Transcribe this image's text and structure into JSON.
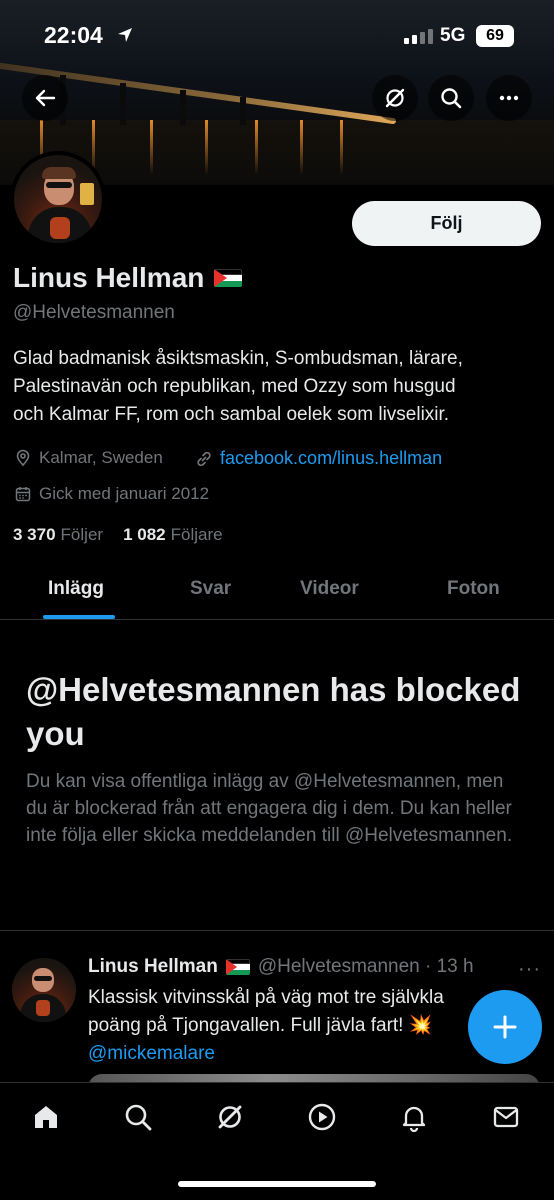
{
  "status_bar": {
    "time": "22:04",
    "network": "5G",
    "battery": "69"
  },
  "profile": {
    "name": "Linus Hellman",
    "handle": "@Helvetesmannen",
    "follow_label": "Följ",
    "bio_lines": [
      "Glad badmanisk åsiktsmaskin, S-ombudsman, lärare,",
      "Palestinavän och republikan, med Ozzy som husgud",
      "och Kalmar FF, rom och sambal oelek som livselixir."
    ],
    "location": "Kalmar, Sweden",
    "link": "facebook.com/linus.hellman",
    "joined": "Gick med januari 2012",
    "following_count": "3 370",
    "following_label": "Följer",
    "followers_count": "1 082",
    "followers_label": "Följare"
  },
  "tabs": [
    {
      "label": "Inlägg",
      "active": true
    },
    {
      "label": "Svar",
      "active": false
    },
    {
      "label": "Videor",
      "active": false
    },
    {
      "label": "Foton",
      "active": false
    }
  ],
  "blocked": {
    "title": "@Helvetesmannen has blocked you",
    "description": "Du kan visa offentliga inlägg av @Helvetesmannen, men du är blockerad från att engagera dig i dem. Du kan heller inte följa eller skicka meddelanden till @Helvetesmannen."
  },
  "tweet": {
    "name": "Linus Hellman",
    "handle_time": "@Helvetesmannen · 13 h",
    "more": "···",
    "line1": "Klassisk vitvinsskål på väg mot tre självkla",
    "line2": "poäng på Tjongavallen. Full jävla fart! 💥",
    "mention": "@mickemalare"
  },
  "icons": {
    "back": "back-arrow-icon",
    "grok": "grok-icon",
    "search": "search-icon",
    "more": "more-icon",
    "location": "location-pin-icon",
    "link": "link-icon",
    "calendar": "calendar-icon",
    "compose": "plus-icon",
    "nav": [
      "home-icon",
      "search-icon",
      "grok-icon",
      "video-play-icon",
      "bell-icon",
      "mail-icon"
    ]
  },
  "colors": {
    "accent": "#1d9bf0",
    "muted": "#71767b",
    "text": "#e7e9ea",
    "background": "#000000"
  }
}
